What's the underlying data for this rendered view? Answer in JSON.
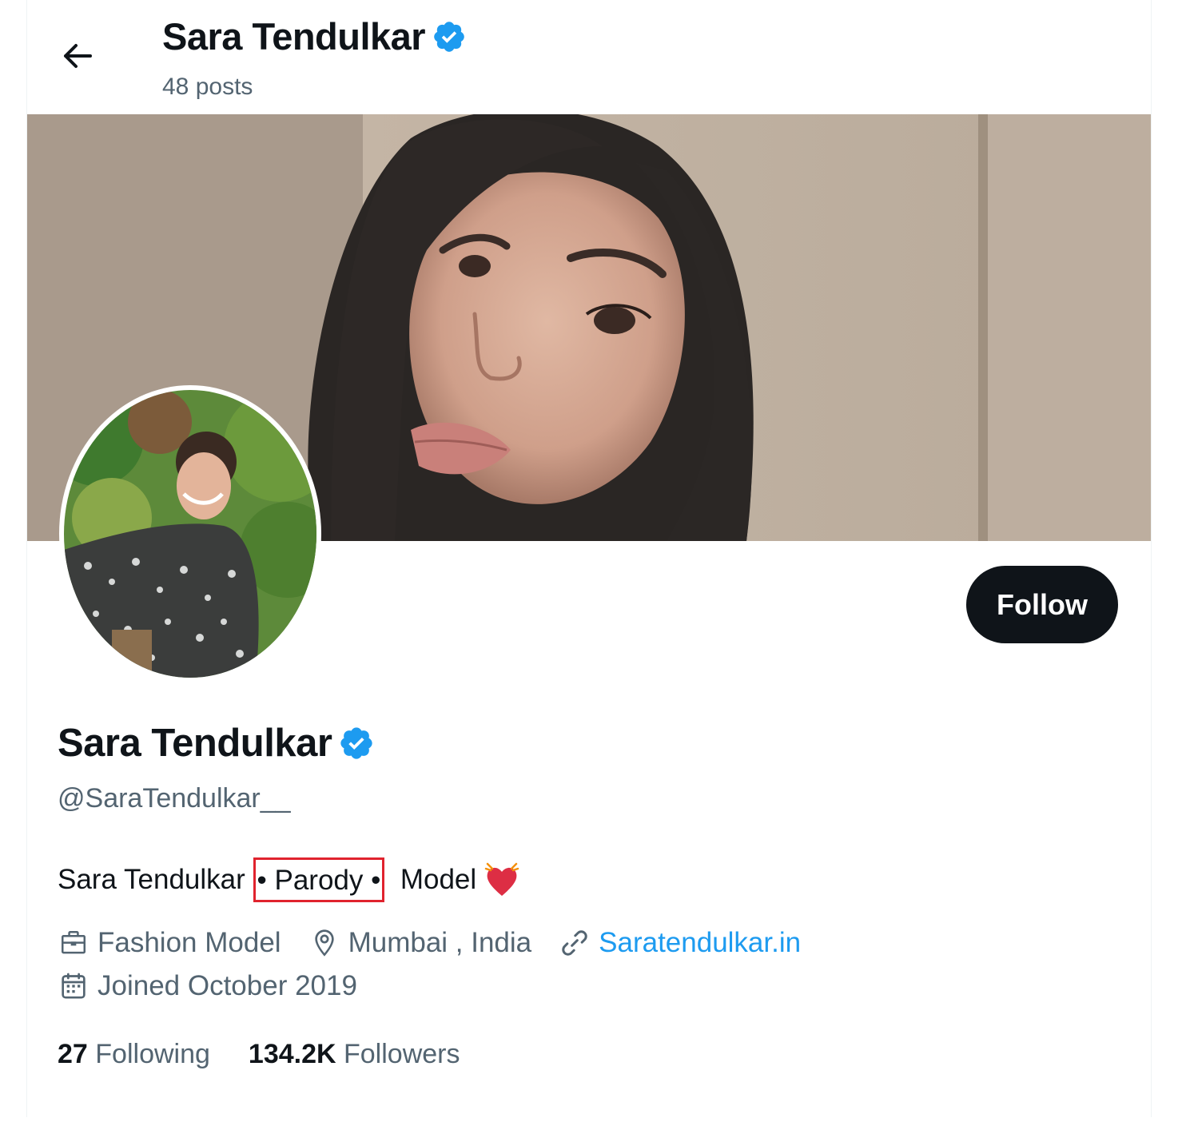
{
  "header": {
    "name": "Sara Tendulkar",
    "posts": "48 posts"
  },
  "profile": {
    "name": "Sara Tendulkar",
    "handle": "@SaraTendulkar__",
    "follow_label": "Follow",
    "bio": {
      "prefix": "Sara Tendulkar ",
      "highlighted": "• Parody •",
      "suffix": "  Model "
    },
    "occupation": "Fashion Model",
    "location": "Mumbai , India",
    "website": "Saratendulkar.in",
    "joined": "Joined October 2019",
    "following_count": "27",
    "following_label": "Following",
    "followers_count": "134.2K",
    "followers_label": "Followers"
  },
  "colors": {
    "verified": "#1d9bf0",
    "highlight_box": "#e0232e",
    "follow_bg": "#0f1419",
    "secondary_text": "#536471"
  },
  "icons": {
    "back": "arrow-left-icon",
    "verified": "verified-badge-icon",
    "occupation": "briefcase-icon",
    "location": "map-pin-icon",
    "website": "link-icon",
    "joined": "calendar-icon",
    "bio_emoji": "heart-icon"
  }
}
